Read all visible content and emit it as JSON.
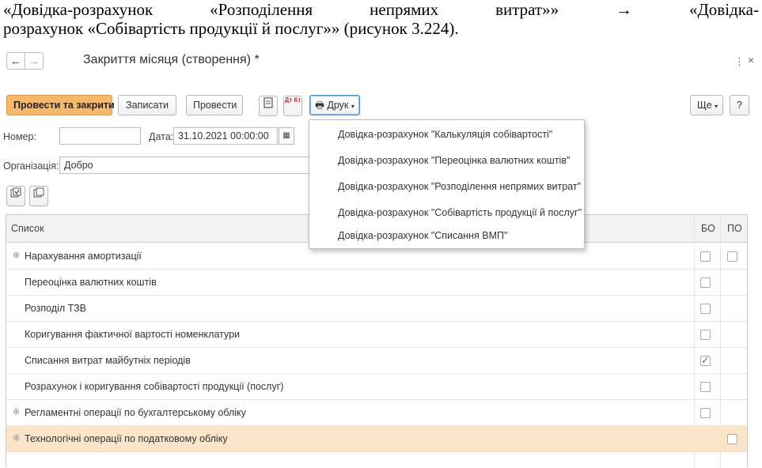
{
  "doc": {
    "line1_parts": [
      "«Довідка-розрахунок",
      "«Розподілення",
      "непрямих",
      "витрат»»",
      "→",
      "«Довідка-"
    ],
    "line2": "розрахунок «Собівартість продукції й послуг»» (рисунок 3.224)."
  },
  "window": {
    "title": "Закриття місяця (створення) *",
    "back_icon": "←",
    "forward_icon": "→",
    "menu_icon": "⋮",
    "close_icon": "×"
  },
  "toolbar": {
    "post_close": "Провести та закрити",
    "save": "Записати",
    "post": "Провести",
    "print": "Друк",
    "more": "Ще",
    "help": "?",
    "dtkt_label": "Дт Кт"
  },
  "print_menu": [
    "Довідка-розрахунок \"Калькуляція собівартості\"",
    "Довідка-розрахунок \"Переоцінка валютних коштів\"",
    "Довідка-розрахунок \"Розподілення непрямих витрат\"",
    "Довідка-розрахунок \"Собівартість продукції й послуг\"",
    "Довідка-розрахунок \"Списання ВМП\""
  ],
  "form": {
    "number_label": "Номер:",
    "number_value": "",
    "date_label": "Дата:",
    "date_value": "31.10.2021 00:00:00",
    "org_label": "Організація:",
    "org_value": "Добро"
  },
  "table": {
    "headers": {
      "list": "Список",
      "bo": "БО",
      "po": "ПО"
    },
    "rows": [
      {
        "name": "Нарахування амортизації",
        "expandable": true,
        "bo": false,
        "po": false,
        "has_po": true
      },
      {
        "name": "Переоцінка валютних коштів",
        "expandable": false,
        "bo": false,
        "has_po": false
      },
      {
        "name": "Розподіл ТЗВ",
        "expandable": false,
        "bo": false,
        "has_po": false
      },
      {
        "name": "Коригування фактичної вартості номенклатури",
        "expandable": false,
        "bo": false,
        "has_po": false
      },
      {
        "name": "Списання витрат майбутніх періодів",
        "expandable": false,
        "bo": true,
        "has_po": false
      },
      {
        "name": "Розрахунок і коригування собівартості продукції (послуг)",
        "expandable": false,
        "bo": false,
        "has_po": false
      },
      {
        "name": "Регламентні операції по бухгалтерському обліку",
        "expandable": true,
        "bo": false,
        "has_po": false
      },
      {
        "name": "Технологічні операції по податковому обліку",
        "expandable": true,
        "has_bo": false,
        "po": false,
        "has_po": true,
        "selected": true
      }
    ]
  }
}
